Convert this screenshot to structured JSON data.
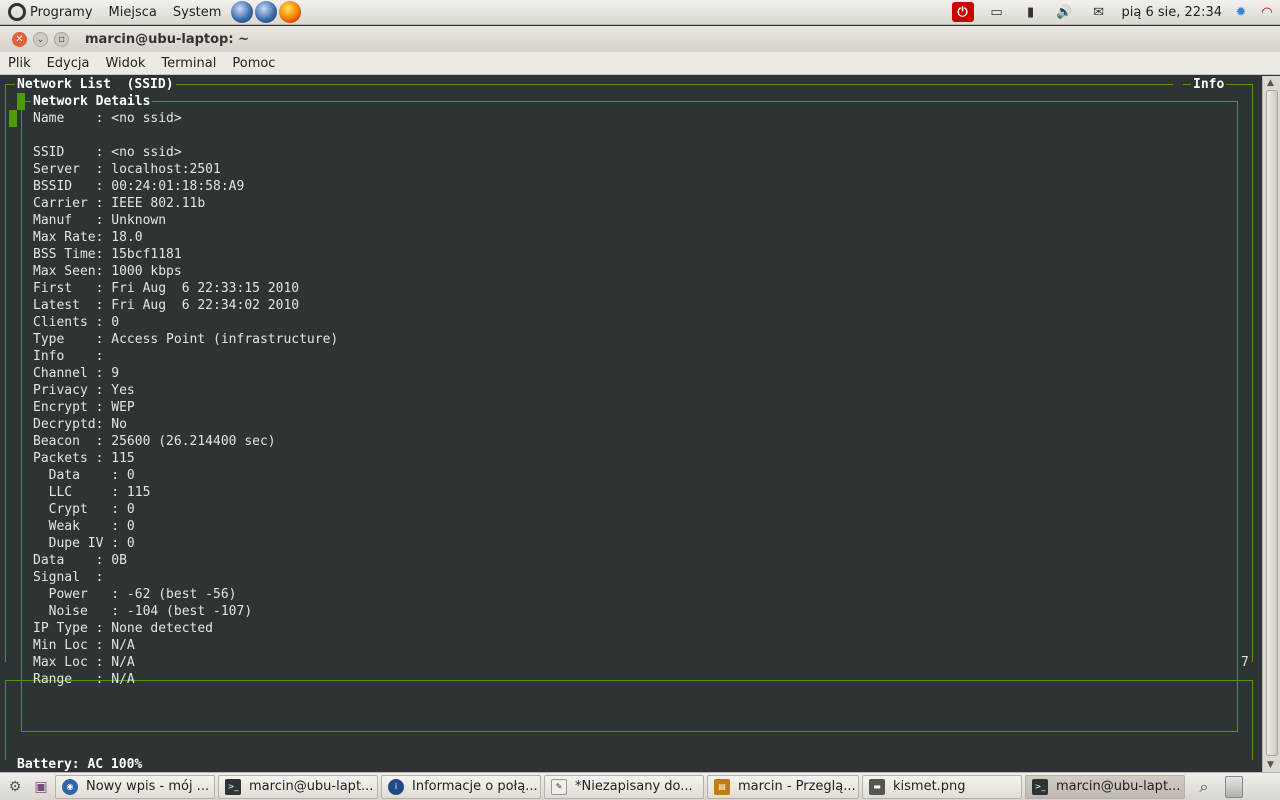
{
  "top_panel": {
    "menus": [
      "Programy",
      "Miejsca",
      "System"
    ],
    "clock": "pią  6 sie, 22:34"
  },
  "window": {
    "title": "marcin@ubu-laptop: ~"
  },
  "terminal_menu": [
    "Plik",
    "Edycja",
    "Widok",
    "Terminal",
    "Pomoc"
  ],
  "kismet": {
    "network_list_title": "Network List  (SSID)",
    "info_title": "Info",
    "details_title": "Network Details",
    "side_number": "7",
    "battery": "Battery: AC 100%",
    "lines": [
      "Name    : <no ssid>",
      "",
      "SSID    : <no ssid>",
      "Server  : localhost:2501",
      "BSSID   : 00:24:01:18:58:A9",
      "Carrier : IEEE 802.11b",
      "Manuf   : Unknown",
      "Max Rate: 18.0",
      "BSS Time: 15bcf1181",
      "Max Seen: 1000 kbps",
      "First   : Fri Aug  6 22:33:15 2010",
      "Latest  : Fri Aug  6 22:34:02 2010",
      "Clients : 0",
      "Type    : Access Point (infrastructure)",
      "Info    :",
      "Channel : 9",
      "Privacy : Yes",
      "Encrypt : WEP",
      "Decryptd: No",
      "Beacon  : 25600 (26.214400 sec)",
      "Packets : 115",
      "  Data    : 0",
      "  LLC     : 115",
      "  Crypt   : 0",
      "  Weak    : 0",
      "  Dupe IV : 0",
      "Data    : 0B",
      "Signal  :",
      "  Power   : -62 (best -56)",
      "  Noise   : -104 (best -107)",
      "IP Type : None detected",
      "Min Loc : N/A",
      "Max Loc : N/A",
      "Range   : N/A"
    ]
  },
  "taskbar": {
    "tasks": [
      {
        "label": "Nowy wpis - mój ...",
        "icon": "browser-icon"
      },
      {
        "label": "marcin@ubu-lapt...",
        "icon": "terminal-icon"
      },
      {
        "label": "Informacje o połą...",
        "icon": "info-icon"
      },
      {
        "label": "*Niezapisany do...",
        "icon": "text-editor-icon"
      },
      {
        "label": "marcin - Przeglą...",
        "icon": "file-manager-icon"
      },
      {
        "label": "kismet.png",
        "icon": "image-icon"
      },
      {
        "label": "marcin@ubu-lapt...",
        "icon": "terminal-icon"
      }
    ]
  }
}
